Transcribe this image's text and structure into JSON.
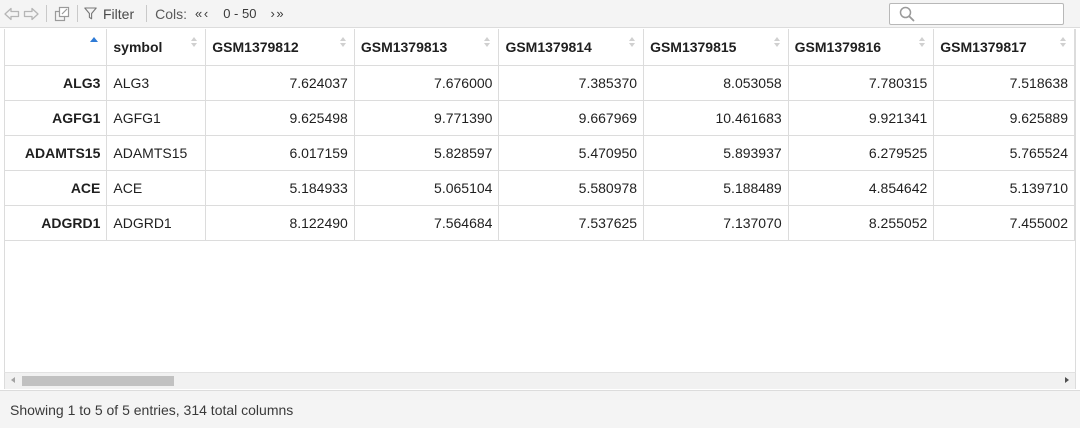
{
  "toolbar": {
    "back_icon": "back-arrow-icon",
    "forward_icon": "forward-arrow-icon",
    "popout_icon": "popout-window-icon",
    "filter_label": "Filter",
    "cols_label": "Cols:",
    "cols_prev": "« ‹",
    "cols_range": "0 - 50",
    "cols_next": "› »",
    "search_placeholder": "",
    "search_value": ""
  },
  "table": {
    "columns": [
      "",
      "symbol",
      "GSM1379812",
      "GSM1379813",
      "GSM1379814",
      "GSM1379815",
      "GSM1379816",
      "GSM1379817"
    ],
    "sorted_column": 0,
    "rows": [
      [
        "ALG3",
        "ALG3",
        "7.624037",
        "7.676000",
        "7.385370",
        "8.053058",
        "7.780315",
        "7.518638"
      ],
      [
        "AGFG1",
        "AGFG1",
        "9.625498",
        "9.771390",
        "9.667969",
        "10.461683",
        "9.921341",
        "9.625889"
      ],
      [
        "ADAMTS15",
        "ADAMTS15",
        "6.017159",
        "5.828597",
        "5.470950",
        "5.893937",
        "6.279525",
        "5.765524"
      ],
      [
        "ACE",
        "ACE",
        "5.184933",
        "5.065104",
        "5.580978",
        "5.188489",
        "4.854642",
        "5.139710"
      ],
      [
        "ADGRD1",
        "ADGRD1",
        "8.122490",
        "7.564684",
        "7.537625",
        "7.137070",
        "8.255052",
        "7.455002"
      ]
    ]
  },
  "scrollbar": {
    "position_fraction": 0.0
  },
  "footer": {
    "status": "Showing 1 to 5 of 5 entries, 314 total columns"
  },
  "colors": {
    "accent": "#2f7bd6",
    "border": "#dcdcdc",
    "toolbar_bg": "#f4f4f4"
  }
}
